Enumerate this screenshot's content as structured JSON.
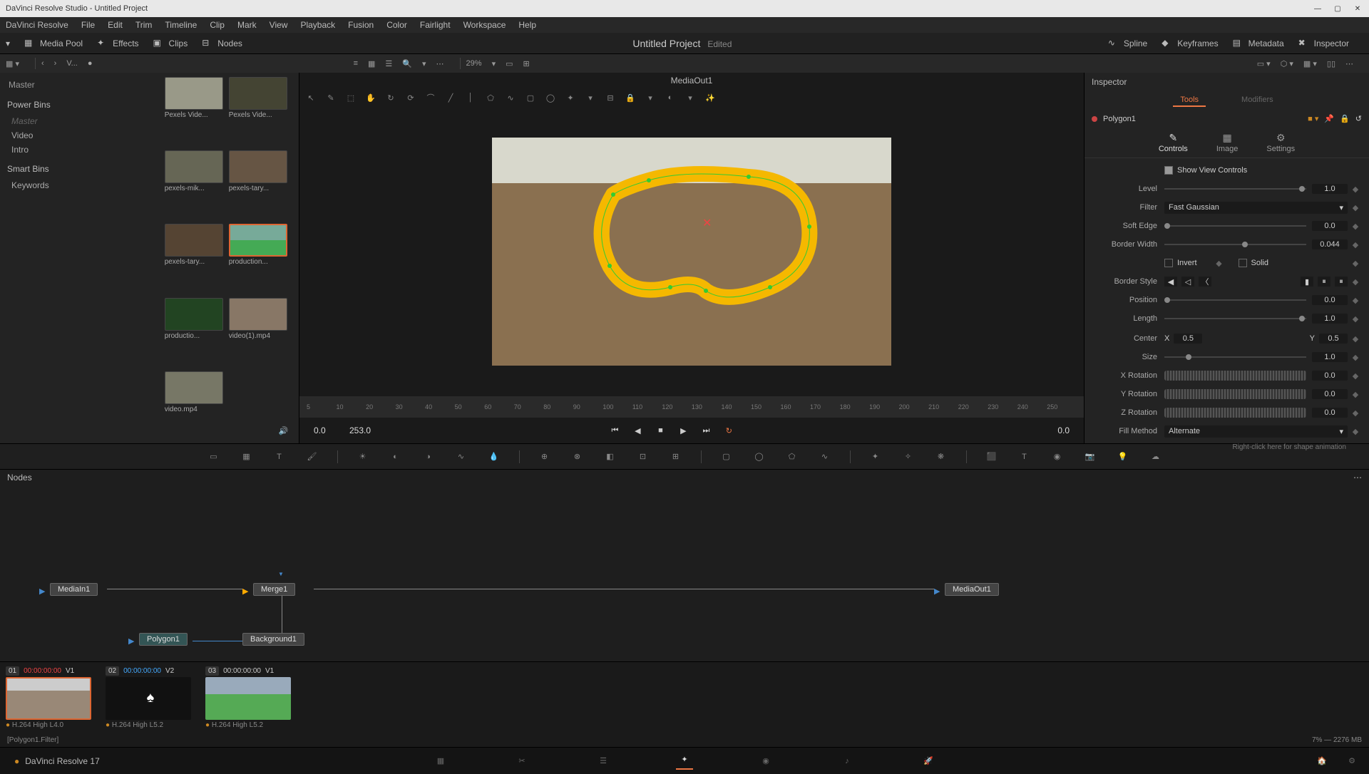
{
  "window": {
    "title": "DaVinci Resolve Studio - Untitled Project"
  },
  "menu": {
    "items": [
      "DaVinci Resolve",
      "File",
      "Edit",
      "Trim",
      "Timeline",
      "Clip",
      "Mark",
      "View",
      "Playback",
      "Fusion",
      "Color",
      "Fairlight",
      "Workspace",
      "Help"
    ]
  },
  "toolbar": {
    "media_pool": "Media Pool",
    "effects": "Effects",
    "clips": "Clips",
    "nodes": "Nodes",
    "spline": "Spline",
    "keyframes": "Keyframes",
    "metadata": "Metadata",
    "inspector": "Inspector",
    "project_title": "Untitled Project",
    "edited": "Edited"
  },
  "sectoolbar": {
    "label": "V...",
    "zoom": "29%"
  },
  "mediapool": {
    "master": "Master",
    "power_bins": "Power Bins",
    "bins": [
      "Master",
      "Video",
      "Intro"
    ],
    "smart_bins": "Smart Bins",
    "keywords": "Keywords",
    "clips": [
      {
        "name": "Pexels Vide..."
      },
      {
        "name": "Pexels Vide..."
      },
      {
        "name": "pexels-mik..."
      },
      {
        "name": "pexels-tary..."
      },
      {
        "name": "pexels-tary..."
      },
      {
        "name": "production..."
      },
      {
        "name": "productio..."
      },
      {
        "name": "video(1).mp4"
      },
      {
        "name": "video.mp4"
      }
    ]
  },
  "viewer": {
    "title": "MediaOut1",
    "tc_left": "0.0",
    "tc_dur": "253.0",
    "tc_right": "0.0",
    "ruler": [
      "5",
      "10",
      "20",
      "30",
      "40",
      "50",
      "60",
      "70",
      "80",
      "90",
      "100",
      "110",
      "120",
      "130",
      "140",
      "150",
      "160",
      "170",
      "180",
      "190",
      "200",
      "210",
      "220",
      "230",
      "240",
      "250"
    ]
  },
  "inspector": {
    "title": "Inspector",
    "tabs": {
      "tools": "Tools",
      "modifiers": "Modifiers"
    },
    "node": "Polygon1",
    "subtabs": {
      "controls": "Controls",
      "image": "Image",
      "settings": "Settings"
    },
    "show_view": "Show View Controls",
    "level": {
      "label": "Level",
      "val": "1.0"
    },
    "filter": {
      "label": "Filter",
      "val": "Fast Gaussian"
    },
    "soft_edge": {
      "label": "Soft Edge",
      "val": "0.0"
    },
    "border_width": {
      "label": "Border Width",
      "val": "0.044"
    },
    "invert": "Invert",
    "solid": "Solid",
    "border_style": "Border Style",
    "position": {
      "label": "Position",
      "val": "0.0"
    },
    "length": {
      "label": "Length",
      "val": "1.0"
    },
    "center": {
      "label": "Center",
      "x_label": "X",
      "x": "0.5",
      "y_label": "Y",
      "y": "0.5"
    },
    "size": {
      "label": "Size",
      "val": "1.0"
    },
    "xrot": {
      "label": "X Rotation",
      "val": "0.0"
    },
    "yrot": {
      "label": "Y Rotation",
      "val": "0.0"
    },
    "zrot": {
      "label": "Z Rotation",
      "val": "0.0"
    },
    "fill": {
      "label": "Fill Method",
      "val": "Alternate"
    },
    "hint": "Right-click here for shape animation"
  },
  "nodes_panel": {
    "title": "Nodes",
    "nodes": {
      "mediain": "MediaIn1",
      "merge": "Merge1",
      "mediaout": "MediaOut1",
      "polygon": "Polygon1",
      "background": "Background1"
    }
  },
  "clipstrip": {
    "clips": [
      {
        "num": "01",
        "tc": "00:00:00:00",
        "trk": "V1",
        "codec": "H.264 High L4.0",
        "tc_class": ""
      },
      {
        "num": "02",
        "tc": "00:00:00:00",
        "trk": "V2",
        "codec": "H.264 High L5.2",
        "tc_class": "b"
      },
      {
        "num": "03",
        "tc": "00:00:00:00",
        "trk": "V1",
        "codec": "H.264 High L5.2",
        "tc_class": ""
      }
    ]
  },
  "statusbar": {
    "hint": "[Polygon1.Filter]",
    "mem": "7% — 2276 MB"
  },
  "app": {
    "name": "DaVinci Resolve 17"
  }
}
